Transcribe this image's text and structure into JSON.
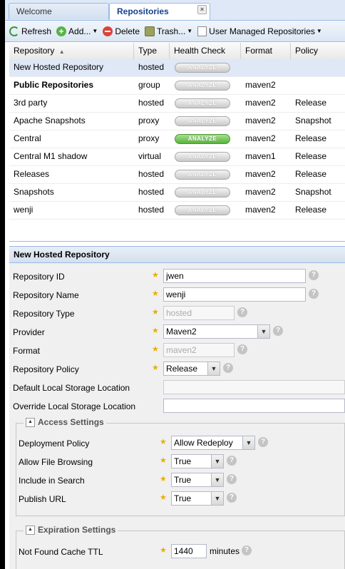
{
  "tabs": [
    {
      "label": "Welcome"
    },
    {
      "label": "Repositories",
      "close": "×"
    }
  ],
  "toolbar": {
    "refresh": "Refresh",
    "add": "Add...",
    "delete": "Delete",
    "trash": "Trash...",
    "user_managed": "User Managed Repositories"
  },
  "grid": {
    "columns": [
      "Repository",
      "Type",
      "Health Check",
      "Format",
      "Policy"
    ],
    "sort_indicator": "▲",
    "analyze_label": "ANALYZE",
    "rows": [
      {
        "name": "New Hosted Repository",
        "type": "hosted",
        "format": "",
        "policy": ""
      },
      {
        "name": "Public Repositories",
        "type": "group",
        "format": "maven2",
        "policy": ""
      },
      {
        "name": "3rd party",
        "type": "hosted",
        "format": "maven2",
        "policy": "Release"
      },
      {
        "name": "Apache Snapshots",
        "type": "proxy",
        "format": "maven2",
        "policy": "Snapshot"
      },
      {
        "name": "Central",
        "type": "proxy",
        "format": "maven2",
        "policy": "Release"
      },
      {
        "name": "Central M1 shadow",
        "type": "virtual",
        "format": "maven1",
        "policy": "Release"
      },
      {
        "name": "Releases",
        "type": "hosted",
        "format": "maven2",
        "policy": "Release"
      },
      {
        "name": "Snapshots",
        "type": "hosted",
        "format": "maven2",
        "policy": "Snapshot"
      },
      {
        "name": "wenji",
        "type": "hosted",
        "format": "maven2",
        "policy": "Release"
      }
    ]
  },
  "form": {
    "title": "New Hosted Repository",
    "help": "?",
    "required_mark": "★",
    "repo_id_label": "Repository ID",
    "repo_id_value": "jwen",
    "repo_name_label": "Repository Name",
    "repo_name_value": "wenji",
    "repo_type_label": "Repository Type",
    "repo_type_value": "hosted",
    "provider_label": "Provider",
    "provider_value": "Maven2",
    "format_label": "Format",
    "format_value": "maven2",
    "policy_label": "Repository Policy",
    "policy_value": "Release",
    "default_storage_label": "Default Local Storage Location",
    "default_storage_value": "",
    "override_storage_label": "Override Local Storage Location",
    "override_storage_value": "",
    "access": {
      "legend": "Access Settings",
      "deployment_label": "Deployment Policy",
      "deployment_value": "Allow Redeploy",
      "browsing_label": "Allow File Browsing",
      "browsing_value": "True",
      "search_label": "Include in Search",
      "search_value": "True",
      "publish_label": "Publish URL",
      "publish_value": "True"
    },
    "expiration": {
      "legend": "Expiration Settings",
      "ttl_label": "Not Found Cache TTL",
      "ttl_value": "1440",
      "ttl_unit": "minutes"
    }
  }
}
